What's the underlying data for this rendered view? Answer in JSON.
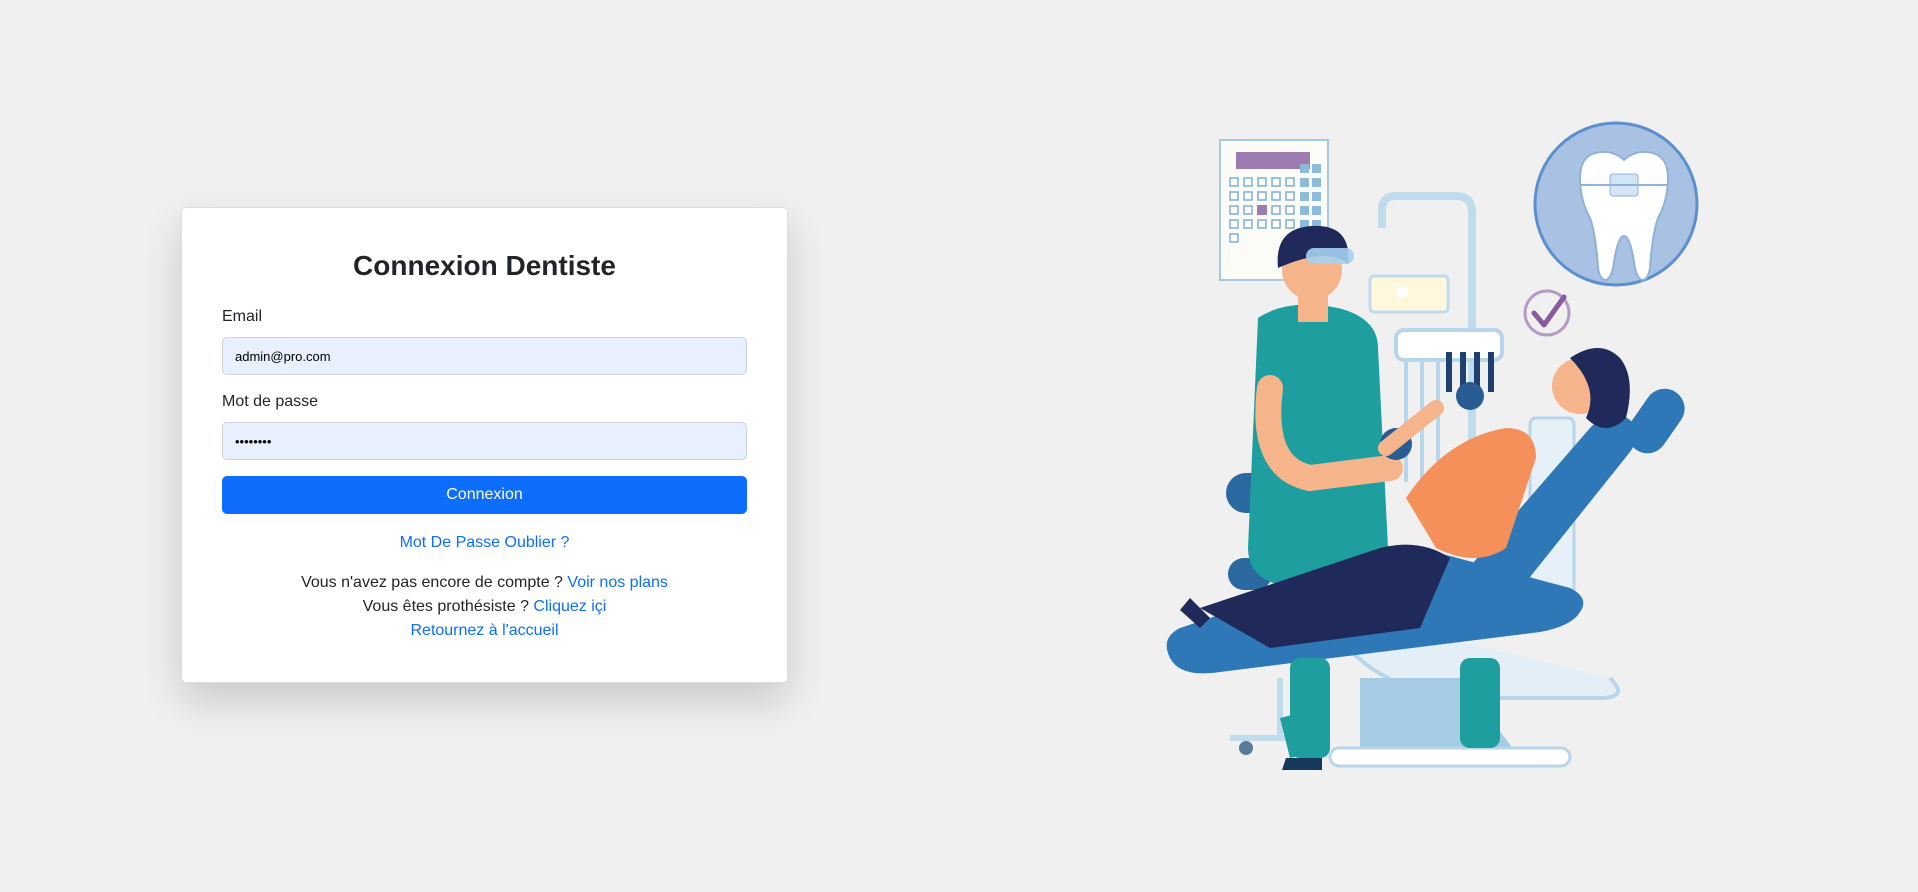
{
  "login": {
    "title": "Connexion Dentiste",
    "email_label": "Email",
    "email_value": "admin@pro.com",
    "password_label": "Mot de passe",
    "password_value": "••••••••",
    "submit_label": "Connexion",
    "forgot_link": "Mot De Passe Oublier ?",
    "no_account_text": "Vous n'avez pas encore de compte ?",
    "plans_link": "Voir nos plans",
    "prosthetist_text": "Vous êtes prothésiste ?",
    "prosthetist_link": "Cliquez içi",
    "home_link": "Retournez à l'accueil"
  },
  "illustration": {
    "icons": [
      "calendar-icon",
      "tooth-icon",
      "checkmark-icon",
      "dental-chair-icon"
    ]
  },
  "colors": {
    "primary": "#0d6efd",
    "background": "#f0f0f0",
    "input_bg": "#e8f0fe",
    "dentist_shirt": "#1e9e9e",
    "chair_blue": "#2e78b8",
    "patient_orange": "#f5905a"
  }
}
